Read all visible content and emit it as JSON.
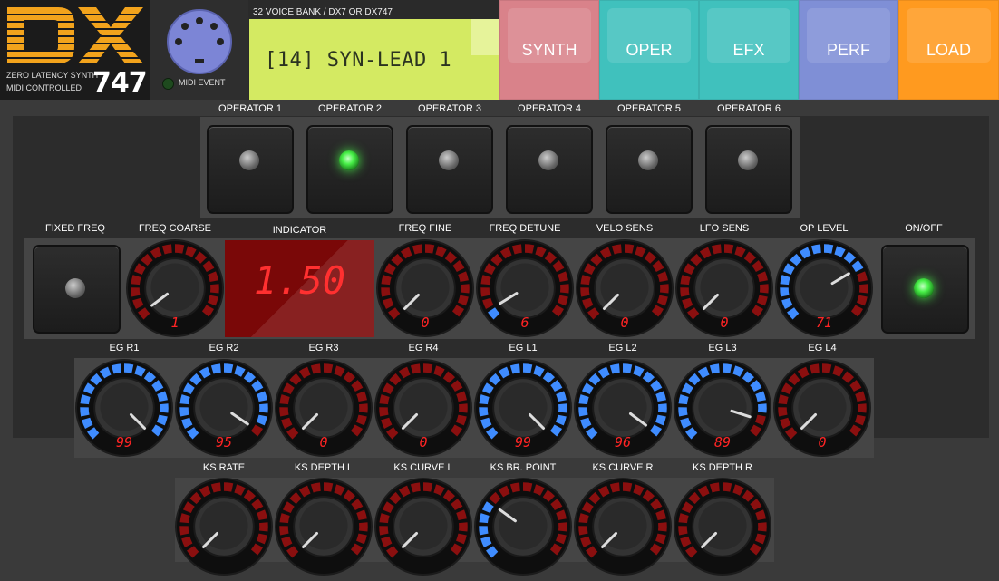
{
  "header": {
    "logo_text": "DX",
    "logo_sub1": "ZERO LATENCY SYNTH",
    "logo_sub2": "MIDI CONTROLLED",
    "logo_number": "747",
    "midi_label": "MIDI EVENT",
    "voice_bank": "32 VOICE BANK / DX7 OR DX747",
    "patch_name": "[14] SYN-LEAD 1",
    "nav": [
      {
        "label": "SYNTH",
        "color": "#d9828a"
      },
      {
        "label": "OPER",
        "color": "#40c1bd"
      },
      {
        "label": "EFX",
        "color": "#40c1bd"
      },
      {
        "label": "PERF",
        "color": "#7f8fd6"
      },
      {
        "label": "LOAD",
        "color": "#ff9a1f"
      }
    ]
  },
  "operators": {
    "labels": [
      "OPERATOR 1",
      "OPERATOR 2",
      "OPERATOR 3",
      "OPERATOR 4",
      "OPERATOR 5",
      "OPERATOR 6"
    ],
    "selected_index": 1
  },
  "row1": {
    "fixed_freq_label": "FIXED FREQ",
    "on_off_label": "ON/OFF",
    "indicator_label": "INDICATOR",
    "indicator_value": "1.50",
    "knobs": [
      {
        "label": "FREQ COARSE",
        "value": "1",
        "fraction": 0.03
      },
      {
        "label": "FREQ FINE",
        "value": "0",
        "fraction": 0.0
      },
      {
        "label": "FREQ DETUNE",
        "value": "6",
        "fraction": 0.05
      },
      {
        "label": "VELO SENS",
        "value": "0",
        "fraction": 0.0
      },
      {
        "label": "LFO SENS",
        "value": "0",
        "fraction": 0.0
      },
      {
        "label": "OP LEVEL",
        "value": "71",
        "fraction": 0.72
      }
    ]
  },
  "eg": {
    "knobs": [
      {
        "label": "EG R1",
        "value": "99",
        "fraction": 1.0
      },
      {
        "label": "EG R2",
        "value": "95",
        "fraction": 0.96
      },
      {
        "label": "EG R3",
        "value": "0",
        "fraction": 0.0
      },
      {
        "label": "EG R4",
        "value": "0",
        "fraction": 0.0
      },
      {
        "label": "EG L1",
        "value": "99",
        "fraction": 1.0
      },
      {
        "label": "EG L2",
        "value": "96",
        "fraction": 0.97
      },
      {
        "label": "EG L3",
        "value": "89",
        "fraction": 0.9
      },
      {
        "label": "EG L4",
        "value": "0",
        "fraction": 0.0
      }
    ]
  },
  "ks": {
    "knobs": [
      {
        "label": "KS RATE",
        "value": "",
        "fraction": 0.0
      },
      {
        "label": "KS DEPTH L",
        "value": "",
        "fraction": 0.0
      },
      {
        "label": "KS CURVE L",
        "value": "",
        "fraction": 0.0
      },
      {
        "label": "KS BR. POINT",
        "value": "",
        "fraction": 0.3
      },
      {
        "label": "KS CURVE R",
        "value": "",
        "fraction": 0.0
      },
      {
        "label": "KS DEPTH R",
        "value": "",
        "fraction": 0.0
      }
    ]
  },
  "colors": {
    "led_on": "#48f048",
    "ring_on": "#3f8cff",
    "ring_off": "#8a0f0f",
    "digit": "#ff2424"
  }
}
